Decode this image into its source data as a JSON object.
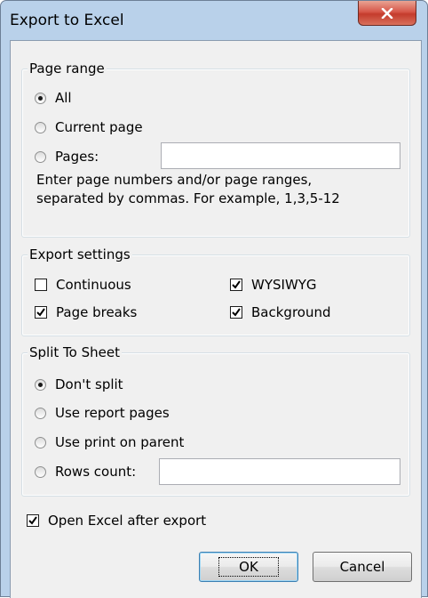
{
  "window": {
    "title": "Export to Excel",
    "close_icon": "close-icon"
  },
  "page_range": {
    "legend": "Page range",
    "options": [
      "All",
      "Current page",
      "Pages:"
    ],
    "selected": "All",
    "pages_value": "",
    "hint_line1": "Enter page numbers and/or page ranges,",
    "hint_line2": "separated by commas. For example, 1,3,5-12"
  },
  "export_settings": {
    "legend": "Export settings",
    "continuous": {
      "label": "Continuous",
      "checked": false
    },
    "wysiwyg": {
      "label": "WYSIWYG",
      "checked": true
    },
    "page_breaks": {
      "label": "Page breaks",
      "checked": true
    },
    "background": {
      "label": "Background",
      "checked": true
    }
  },
  "split_to_sheet": {
    "legend": "Split To Sheet",
    "options": [
      "Don't split",
      "Use report pages",
      "Use print on parent",
      "Rows count:"
    ],
    "selected": "Don't split",
    "rows_count_value": ""
  },
  "open_excel": {
    "label": "Open Excel after export",
    "checked": true
  },
  "buttons": {
    "ok": "OK",
    "cancel": "Cancel"
  }
}
